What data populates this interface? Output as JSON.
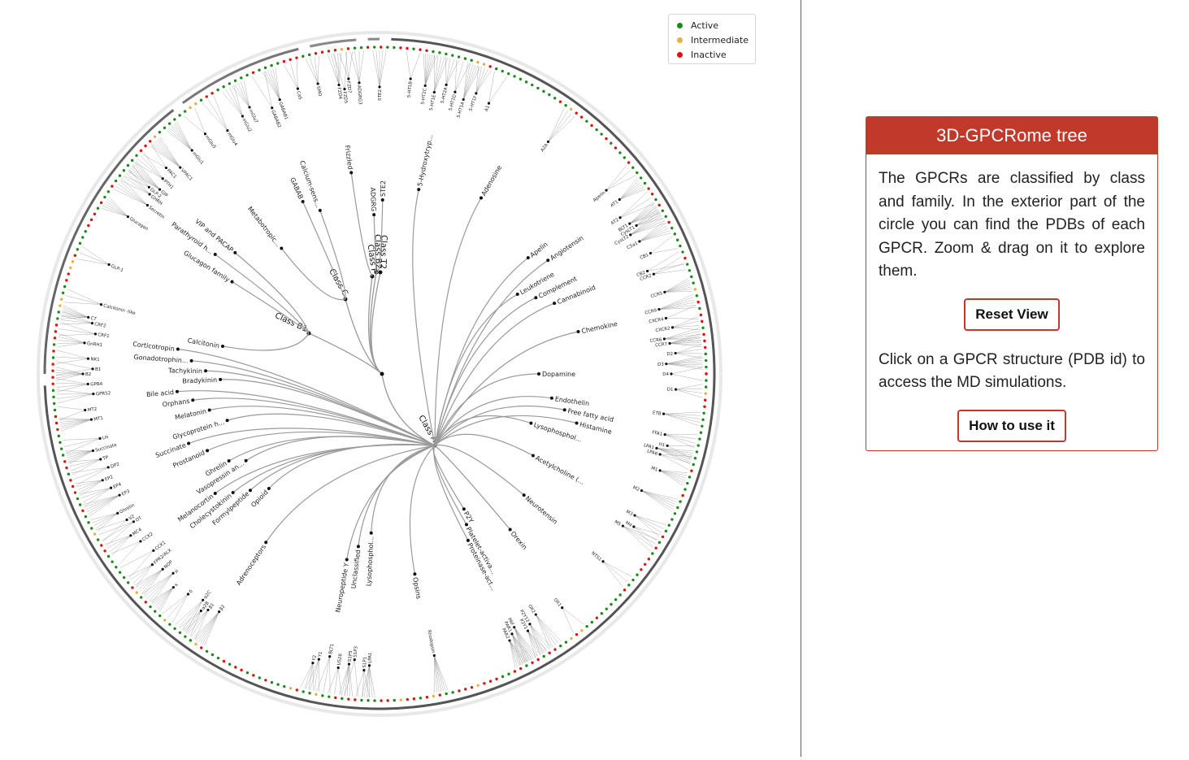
{
  "legend": {
    "items": [
      {
        "label": "Active",
        "color": "#1a8a1a"
      },
      {
        "label": "Intermediate",
        "color": "#e8b040"
      },
      {
        "label": "Inactive",
        "color": "#e01010"
      }
    ]
  },
  "panel": {
    "title": "3D-GPCRome tree",
    "description": "The GPCRs are classified by class and family. In the exterior part of the circle you can find the PDBs of each GPCR. Zoom & drag on it to explore them.",
    "reset_label": "Reset View",
    "instruction": "Click on a GPCR structure (PDB id) to access the MD simulations.",
    "howto_label": "How to use it"
  },
  "tree": {
    "classes": [
      {
        "label": "Class A",
        "angle": 120
      },
      {
        "label": "Class B1",
        "angle": 205
      },
      {
        "label": "Class B2",
        "angle": 268
      },
      {
        "label": "Class C",
        "angle": 240
      },
      {
        "label": "Class F",
        "angle": 262
      },
      {
        "label": "Class T2",
        "angle": 272
      }
    ],
    "families": [
      {
        "label": "Adenosine",
        "angle": 300
      },
      {
        "label": "5-Hydroxytryp...",
        "angle": 282
      },
      {
        "label": "STE2",
        "angle": 271
      },
      {
        "label": "ADGRG",
        "angle": 268
      },
      {
        "label": "Frizzled",
        "angle": 262
      },
      {
        "label": "GABAB",
        "angle": 246
      },
      {
        "label": "Calcium-sens...",
        "angle": 250
      },
      {
        "label": "Metabotropic...",
        "angle": 232
      },
      {
        "label": "Parathyroid h...",
        "angle": 216
      },
      {
        "label": "VIP and PACAP",
        "angle": 220
      },
      {
        "label": "Glucagon family",
        "angle": 212
      },
      {
        "label": "Calcitonin",
        "angle": 190
      },
      {
        "label": "Corticotropin",
        "angle": 187
      },
      {
        "label": "Gonadotrophin...",
        "angle": 184
      },
      {
        "label": "Tachykinin",
        "angle": 181
      },
      {
        "label": "Bradykinin",
        "angle": 178
      },
      {
        "label": "Bile acid",
        "angle": 175
      },
      {
        "label": "Orphans",
        "angle": 172
      },
      {
        "label": "Melatonin",
        "angle": 168
      },
      {
        "label": "Glycoprotein h...",
        "angle": 163
      },
      {
        "label": "Succinate",
        "angle": 160
      },
      {
        "label": "Prostanoid",
        "angle": 156
      },
      {
        "label": "Ghrelin",
        "angle": 150
      },
      {
        "label": "Vasopressin an...",
        "angle": 147
      },
      {
        "label": "Melanocortin",
        "angle": 144
      },
      {
        "label": "Cholecystokinin",
        "angle": 141
      },
      {
        "label": "Formylpeptide",
        "angle": 138
      },
      {
        "label": "Opioid",
        "angle": 134
      },
      {
        "label": "Adrenoceptors",
        "angle": 124
      },
      {
        "label": "Neuropeptide Y",
        "angle": 100
      },
      {
        "label": "Unclassified",
        "angle": 97
      },
      {
        "label": "Lysophosphol...",
        "angle": 93
      },
      {
        "label": "Opsins",
        "angle": 80
      },
      {
        "label": "Proteinase-act...",
        "angle": 62
      },
      {
        "label": "Platelet-activa...",
        "angle": 60
      },
      {
        "label": "P2Y",
        "angle": 58
      },
      {
        "label": "Orexin",
        "angle": 50
      },
      {
        "label": "Neurotensin",
        "angle": 40
      },
      {
        "label": "Acetylcholine (...",
        "angle": 28
      },
      {
        "label": "Lysophosphol...",
        "angle": 18
      },
      {
        "label": "Histamine",
        "angle": 14
      },
      {
        "label": "Free fatty acid",
        "angle": 11
      },
      {
        "label": "Endothelin",
        "angle": 8
      },
      {
        "label": "Dopamine",
        "angle": 0
      },
      {
        "label": "Chemokine",
        "angle": 348
      },
      {
        "label": "Cannabinoid",
        "angle": 338
      },
      {
        "label": "Complement",
        "angle": 334
      },
      {
        "label": "Leukotriene",
        "angle": 330
      },
      {
        "label": "Angiotensin",
        "angle": 326
      },
      {
        "label": "Apelin",
        "angle": 322
      }
    ],
    "receptors": [
      {
        "label": "SMO",
        "angle": 258
      },
      {
        "label": "FZD4",
        "angle": 262
      },
      {
        "label": "FZD5",
        "angle": 263
      },
      {
        "label": "FZD7",
        "angle": 264
      },
      {
        "label": "ADGRG3",
        "angle": 266
      },
      {
        "label": "STE2",
        "angle": 270
      },
      {
        "label": "5-HT1B",
        "angle": 276
      },
      {
        "label": "5-HT2C",
        "angle": 279
      },
      {
        "label": "5-HT1E",
        "angle": 281
      },
      {
        "label": "5-HT2A",
        "angle": 283
      },
      {
        "label": "5-HT1D",
        "angle": 285
      },
      {
        "label": "5-HT1A",
        "angle": 287
      },
      {
        "label": "5-HT1F",
        "angle": 289
      },
      {
        "label": "A1",
        "angle": 292
      },
      {
        "label": "A2A",
        "angle": 306
      },
      {
        "label": "CaS",
        "angle": 254
      },
      {
        "label": "GABAB1",
        "angle": 250
      },
      {
        "label": "GABAB2",
        "angle": 248
      },
      {
        "label": "mGlu7",
        "angle": 244
      },
      {
        "label": "mGlu2",
        "angle": 242
      },
      {
        "label": "mGlu4",
        "angle": 238
      },
      {
        "label": "mGlu5",
        "angle": 234
      },
      {
        "label": "mGlu1",
        "angle": 230
      },
      {
        "label": "VPAC1",
        "angle": 226
      },
      {
        "label": "PAC1",
        "angle": 224
      },
      {
        "label": "PTH1",
        "angle": 222
      },
      {
        "label": "GIP",
        "angle": 220
      },
      {
        "label": "GLP-2",
        "angle": 219
      },
      {
        "label": "GHRH",
        "angle": 218
      },
      {
        "label": "Secretin",
        "angle": 216
      },
      {
        "label": "Glucagon",
        "angle": 212
      },
      {
        "label": "GLP-1",
        "angle": 202
      },
      {
        "label": "Calcitonin -like",
        "angle": 194
      },
      {
        "label": "CT",
        "angle": 191
      },
      {
        "label": "CRF2",
        "angle": 190
      },
      {
        "label": "CRF1",
        "angle": 188
      },
      {
        "label": "GnRH1",
        "angle": 186
      },
      {
        "label": "NK1",
        "angle": 183
      },
      {
        "label": "B1",
        "angle": 181
      },
      {
        "label": "B2",
        "angle": 180
      },
      {
        "label": "GPBA",
        "angle": 178
      },
      {
        "label": "GPR52",
        "angle": 176
      },
      {
        "label": "MT2",
        "angle": 173
      },
      {
        "label": "MT1",
        "angle": 171
      },
      {
        "label": "LH",
        "angle": 167
      },
      {
        "label": "Succinate",
        "angle": 165
      },
      {
        "label": "TP",
        "angle": 163
      },
      {
        "label": "DP2",
        "angle": 161
      },
      {
        "label": "EP2",
        "angle": 159
      },
      {
        "label": "EP4",
        "angle": 157
      },
      {
        "label": "EP3",
        "angle": 155
      },
      {
        "label": "Ghrelin",
        "angle": 152
      },
      {
        "label": "V2",
        "angle": 150
      },
      {
        "label": "OT",
        "angle": 149
      },
      {
        "label": "MC4",
        "angle": 147
      },
      {
        "label": "CCK2",
        "angle": 145
      },
      {
        "label": "CCK1",
        "angle": 142
      },
      {
        "label": "FPR2/ALX",
        "angle": 140
      },
      {
        "label": "NOP",
        "angle": 138
      },
      {
        "label": "μ",
        "angle": 136
      },
      {
        "label": "κ",
        "angle": 134
      },
      {
        "label": "δ",
        "angle": 131
      },
      {
        "label": "α2C",
        "angle": 128
      },
      {
        "label": "α2B",
        "angle": 127
      },
      {
        "label": "β1",
        "angle": 126
      },
      {
        "label": "β2",
        "angle": 124
      },
      {
        "label": "Y2",
        "angle": 103
      },
      {
        "label": "Y1",
        "angle": 102
      },
      {
        "label": "BLT1",
        "angle": 100
      },
      {
        "label": "US28",
        "angle": 98
      },
      {
        "label": "S1P5",
        "angle": 96
      },
      {
        "label": "S1P3",
        "angle": 95
      },
      {
        "label": "S1P1",
        "angle": 93
      },
      {
        "label": "LPA1",
        "angle": 92
      },
      {
        "label": "Rhodopsin",
        "angle": 79
      },
      {
        "label": "PAR2",
        "angle": 64
      },
      {
        "label": "PAR1",
        "angle": 63
      },
      {
        "label": "PAF",
        "angle": 62
      },
      {
        "label": "P2Y1",
        "angle": 60
      },
      {
        "label": "P2Y12",
        "angle": 59
      },
      {
        "label": "OX2",
        "angle": 57
      },
      {
        "label": "OX1",
        "angle": 52
      },
      {
        "label": "NTS1",
        "angle": 40
      },
      {
        "label": "M5",
        "angle": 32
      },
      {
        "label": "M4",
        "angle": 31
      },
      {
        "label": "M3",
        "angle": 29
      },
      {
        "label": "M2",
        "angle": 24
      },
      {
        "label": "M1",
        "angle": 19
      },
      {
        "label": "LPA6",
        "angle": 16
      },
      {
        "label": "LPA1",
        "angle": 15
      },
      {
        "label": "H1",
        "angle": 14
      },
      {
        "label": "FFA1",
        "angle": 12
      },
      {
        "label": "ETB",
        "angle": 8
      },
      {
        "label": "D1",
        "angle": 3
      },
      {
        "label": "D4",
        "angle": 0
      },
      {
        "label": "D3",
        "angle": 358
      },
      {
        "label": "D2",
        "angle": 356
      },
      {
        "label": "CCR7",
        "angle": 354
      },
      {
        "label": "CCR6",
        "angle": 353
      },
      {
        "label": "CXCR2",
        "angle": 351
      },
      {
        "label": "CXCR4",
        "angle": 349
      },
      {
        "label": "CCR9",
        "angle": 347
      },
      {
        "label": "CCR5",
        "angle": 344
      },
      {
        "label": "CCR2",
        "angle": 340
      },
      {
        "label": "CB2",
        "angle": 339
      },
      {
        "label": "CB1",
        "angle": 336
      },
      {
        "label": "C5a1",
        "angle": 333
      },
      {
        "label": "CysLT2",
        "angle": 331
      },
      {
        "label": "CysLT1",
        "angle": 330
      },
      {
        "label": "BLT1",
        "angle": 329
      },
      {
        "label": "AT2",
        "angle": 327
      },
      {
        "label": "AT1",
        "angle": 324
      },
      {
        "label": "Apelin",
        "angle": 321
      }
    ]
  }
}
